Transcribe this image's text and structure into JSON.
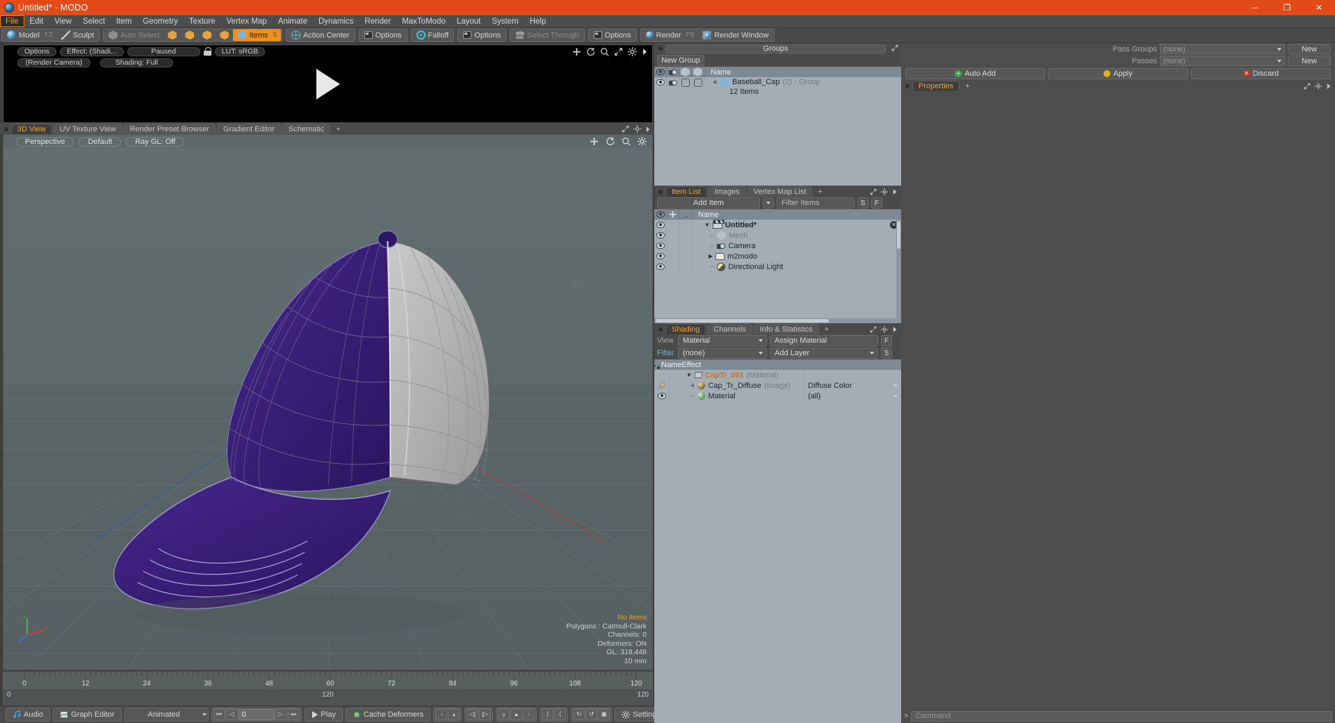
{
  "window": {
    "title": "Untitled* - MODO",
    "app_icon": "modo-sphere-icon",
    "minimize": "─",
    "maximize": "❐",
    "close": "✕"
  },
  "menubar": {
    "items": [
      {
        "label": "File",
        "active": true
      },
      {
        "label": "Edit",
        "active": false
      },
      {
        "label": "View",
        "active": false
      },
      {
        "label": "Select",
        "active": false
      },
      {
        "label": "Item",
        "active": false
      },
      {
        "label": "Geometry",
        "active": false
      },
      {
        "label": "Texture",
        "active": false
      },
      {
        "label": "Vertex Map",
        "active": false
      },
      {
        "label": "Animate",
        "active": false
      },
      {
        "label": "Dynamics",
        "active": false
      },
      {
        "label": "Render",
        "active": false
      },
      {
        "label": "MaxToModo",
        "active": false
      },
      {
        "label": "Layout",
        "active": false
      },
      {
        "label": "System",
        "active": false
      },
      {
        "label": "Help",
        "active": false
      }
    ]
  },
  "toolbar": {
    "model": "Model",
    "model_key": "F2",
    "sculpt": "Sculpt",
    "auto_select": "Auto Select",
    "items": "Items",
    "items_key": "5",
    "action_center": "Action Center",
    "options_1": "Options",
    "falloff": "Falloff",
    "options_2": "Options",
    "select_through": "Select Through",
    "options_3": "Options",
    "render": "Render",
    "render_key": "F9",
    "render_window": "Render Window"
  },
  "render_preview": {
    "options": "Options",
    "effect": "Effect: (Shadi...",
    "paused": "Paused",
    "lut": "LUT: sRGB",
    "camera": "(Render Camera)",
    "shading": "Shading: Full",
    "icons": [
      "move-icon",
      "rotate-icon",
      "zoom-icon",
      "fit-icon",
      "gear-icon",
      "chevron-right-icon"
    ]
  },
  "viewport_tabs": {
    "tabs": [
      {
        "label": "3D View",
        "active": true
      },
      {
        "label": "UV Texture View",
        "active": false
      },
      {
        "label": "Render Preset Browser",
        "active": false
      },
      {
        "label": "Gradient Editor",
        "active": false
      },
      {
        "label": "Schematic",
        "active": false
      }
    ],
    "add": "+"
  },
  "viewport": {
    "projection": "Perspective",
    "preset": "Default",
    "raygl": "Ray GL: Off",
    "icons": [
      "move-icon",
      "rotate-icon",
      "zoom-icon",
      "gear-icon"
    ],
    "axis_z_label": "-Z",
    "axis_widget": {
      "x": "x",
      "y": "y",
      "z": "z"
    },
    "stats": [
      {
        "text": "No Items",
        "highlight": true
      },
      {
        "text": "Polygons : Catmull-Clark",
        "highlight": false
      },
      {
        "text": "Channels: 0",
        "highlight": false
      },
      {
        "text": "Deformers: ON",
        "highlight": false
      },
      {
        "text": "GL: 318,448",
        "highlight": false
      },
      {
        "text": "10 mm",
        "highlight": false
      }
    ]
  },
  "timeline": {
    "ticks": [
      "0",
      "12",
      "24",
      "36",
      "48",
      "60",
      "72",
      "84",
      "96",
      "108",
      "120"
    ],
    "range_start": "0",
    "range_mid": "120",
    "range_end": "120"
  },
  "bottombar": {
    "audio": "Audio",
    "graph_editor": "Graph Editor",
    "animated": "Animated",
    "frame_value": "0",
    "play": "Play",
    "cache_deformers": "Cache Deformers",
    "settings": "Settings",
    "transport": [
      "first-frame-icon",
      "prev-frame-icon",
      "next-frame-icon",
      "last-frame-icon"
    ],
    "tool_icons": [
      "ik-icon",
      "fk-icon",
      "key-prev-icon",
      "key-next-icon",
      "vertex-key-icon",
      "item-key-icon",
      "channel-key-icon",
      "range-in-icon",
      "range-out-icon",
      "cycle-icon",
      "cycle-rev-icon",
      "bake-icon"
    ]
  },
  "groups_panel": {
    "title": "Groups",
    "new_group": "New Group",
    "columns": [
      "eye-icon",
      "camera-icon",
      "hex-outline-icon",
      "hex-solid-icon",
      "Name"
    ],
    "name_header": "Name",
    "rows": [
      {
        "expand": "+",
        "name": "Baseball_Cap",
        "count": "(2)",
        "type": ": Group",
        "sub": "12 Items"
      }
    ]
  },
  "item_list_panel": {
    "tabs": [
      {
        "label": "Item List",
        "active": true
      },
      {
        "label": "Images",
        "active": false
      },
      {
        "label": "Vertex Map List",
        "active": false
      }
    ],
    "add": "+",
    "add_item": "Add Item",
    "filter_placeholder": "Filter Items",
    "btn_s": "S",
    "btn_f": "F",
    "name_header": "Name",
    "rows": [
      {
        "indent": 0,
        "icon": "clapper-icon",
        "name": "Untitled*",
        "bold": true,
        "muted": false,
        "expander": "collapse",
        "close": true
      },
      {
        "indent": 1,
        "icon": "mesh-icon",
        "name": "Mesh",
        "bold": false,
        "muted": true,
        "expander": "leaf",
        "close": false
      },
      {
        "indent": 1,
        "icon": "camera-icon",
        "name": "Camera",
        "bold": false,
        "muted": false,
        "expander": "leaf",
        "close": false
      },
      {
        "indent": 1,
        "icon": "folder-icon",
        "name": "m2modo",
        "bold": false,
        "muted": false,
        "expander": "expand",
        "close": false
      },
      {
        "indent": 1,
        "icon": "light-icon",
        "name": "Directional Light",
        "bold": false,
        "muted": false,
        "expander": "leaf",
        "close": false
      }
    ]
  },
  "shading_panel": {
    "tabs": [
      {
        "label": "Shading",
        "active": true
      },
      {
        "label": "Channels",
        "active": false
      },
      {
        "label": "Info & Statistics",
        "active": false
      }
    ],
    "add": "+",
    "view_label": "View",
    "view_value": "Material",
    "assign_material": "Assign Material",
    "btn_f": "F",
    "filter_label": "Filter",
    "filter_value": "(none)",
    "add_layer": "Add Layer",
    "btn_s": "S",
    "col_name": "Name",
    "col_effect": "Effect",
    "rows": [
      {
        "icon": "material-tag-icon",
        "name": "CapTr_001",
        "suffix": "(Material)",
        "effect": "",
        "accent": true,
        "dropdown": false
      },
      {
        "icon": "brush-icon",
        "name": "Cap_Tr_Diffuse",
        "suffix": "(Image)",
        "effect": "Diffuse Color",
        "accent": false,
        "dropdown": true,
        "expand": "+"
      },
      {
        "icon": "eye-icon",
        "name": "Material",
        "suffix": "",
        "effect": "(all)",
        "accent": false,
        "dropdown": true
      }
    ]
  },
  "properties_panel": {
    "pass_groups_label": "Pass Groups",
    "pass_groups_value": "(none)",
    "passes_label": "Passes",
    "passes_value": "(none)",
    "new_1": "New",
    "new_2": "New",
    "auto_add": "Auto Add",
    "apply": "Apply",
    "discard": "Discard",
    "tabs": [
      {
        "label": "Properties",
        "active": true
      }
    ],
    "add": "+"
  },
  "command_bar": {
    "prompt": ">",
    "placeholder": "Command"
  },
  "colors": {
    "title_bg": "#e24a18",
    "accent_orange": "#f0a12c",
    "panel_bg": "#4a4a4a",
    "list_bg": "#a3adb5",
    "list_header": "#7e8a93",
    "viewport_bg": "#5d686a",
    "cap_purple": "#3c1f78",
    "cap_gray": "#b3b3b3"
  }
}
